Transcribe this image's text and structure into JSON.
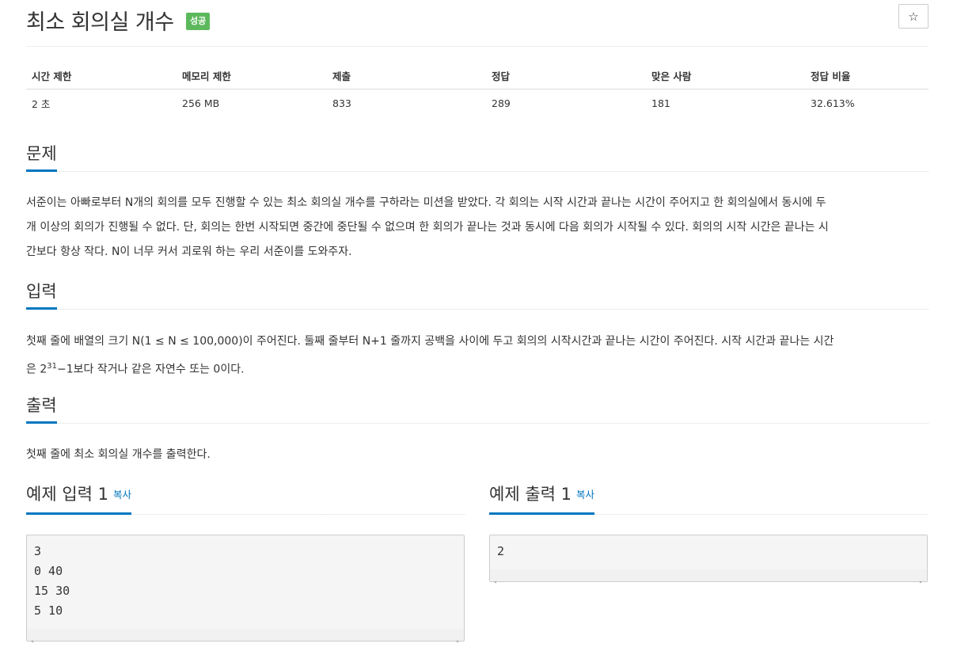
{
  "problem": {
    "title": "최소 회의실 개수",
    "badge": "성공",
    "star_icon": "☆"
  },
  "info_table": {
    "headers": [
      "시간 제한",
      "메모리 제한",
      "제출",
      "정답",
      "맞은 사람",
      "정답 비율"
    ],
    "values": [
      "2 초",
      "256 MB",
      "833",
      "289",
      "181",
      "32.613%"
    ]
  },
  "sections": {
    "problem_heading": "문제",
    "problem_text_1": "서준이는 아빠로부터 N개의 회의를 모두 진행할 수 있는 최소 회의실 개수를 구하라는 미션을 받았다. 각 회의는 시작 시간과 끝나는 시간이 주어지고 한 회의실에서 동시에 두",
    "problem_text_2": "개 이상의 회의가 진행될 수 없다. 단, 회의는 한번 시작되면 중간에 중단될 수 없으며 한 회의가 끝나는 것과 동시에 다음 회의가 시작될 수 있다. 회의의 시작 시간은 끝나는 시",
    "problem_text_3": "간보다 항상 작다. N이 너무 커서 괴로워 하는 우리 서준이를 도와주자.",
    "input_heading": "입력",
    "input_text_1": "첫째 줄에 배열의 크기 N(1 ≤ N ≤ 100,000)이 주어진다. 둘째 줄부터 N+1 줄까지 공백을 사이에 두고 회의의 시작시간과 끝나는 시간이 주어진다. 시작 시간과 끝나는 시간",
    "input_text_2a": "은 2",
    "input_text_2sup": "31",
    "input_text_2b": "−1보다 작거나 같은 자연수 또는 0이다.",
    "output_heading": "출력",
    "output_text": "첫째 줄에 최소 회의실 개수를 출력한다."
  },
  "examples": {
    "input_title": "예제 입력 1",
    "output_title": "예제 출력 1",
    "copy_label": "복사",
    "input_code": "3\n0 40\n15 30\n5 10",
    "output_code": "2",
    "scroll_left": "◂",
    "scroll_right": "▸"
  }
}
